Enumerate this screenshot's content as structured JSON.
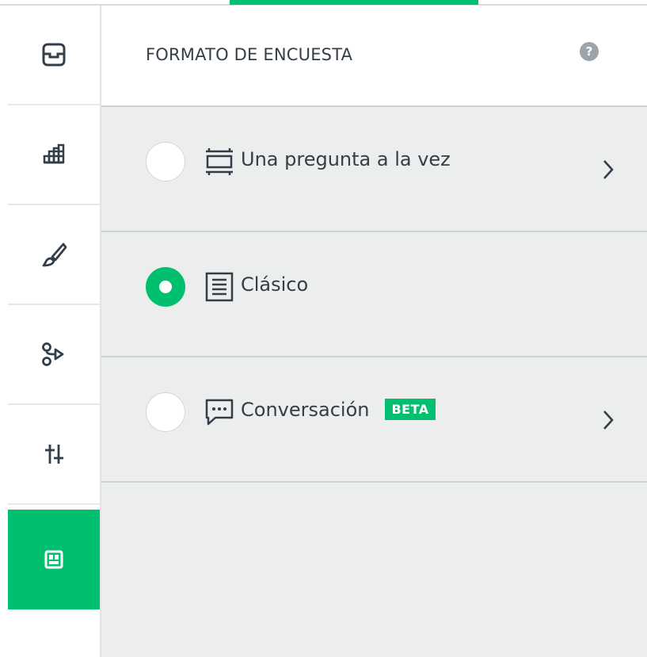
{
  "colors": {
    "accent": "#00bf6f",
    "panel_bg": "#eceded",
    "text": "#333e48",
    "divider": "#cfd2d4"
  },
  "sidebar": {
    "items": [
      {
        "icon": "inbox-icon",
        "active": false
      },
      {
        "icon": "chart-bars-icon",
        "active": false
      },
      {
        "icon": "brush-icon",
        "active": false
      },
      {
        "icon": "logic-branch-icon",
        "active": false
      },
      {
        "icon": "sliders-icon",
        "active": false
      },
      {
        "icon": "layout-format-icon",
        "active": true
      }
    ]
  },
  "panel": {
    "title": "FORMATO DE ENCUESTA",
    "help_label": "?",
    "options": [
      {
        "label": "Una pregunta a la vez",
        "icon": "one-question-icon",
        "selected": false,
        "has_chevron": true
      },
      {
        "label": "Clásico",
        "icon": "classic-list-icon",
        "selected": true,
        "has_chevron": false
      },
      {
        "label": "Conversación",
        "icon": "chat-bubble-icon",
        "selected": false,
        "has_chevron": true,
        "badge": "BETA"
      }
    ]
  }
}
